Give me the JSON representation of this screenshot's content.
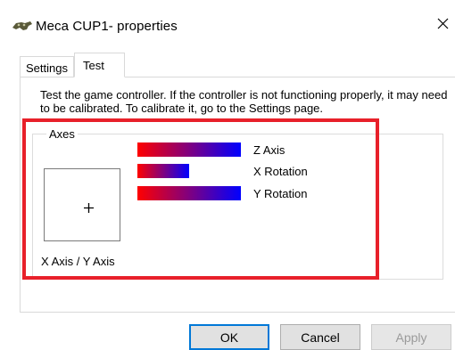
{
  "window": {
    "title": "Meca CUP1- properties",
    "close_label": "✕"
  },
  "tabs": [
    {
      "label": "Settings",
      "active": false
    },
    {
      "label": "Test",
      "active": true
    }
  ],
  "test_panel": {
    "description": "Test the game controller.  If the controller is not functioning properly, it may need to be calibrated.  To calibrate it, go to the Settings page.",
    "axes_group_label": "Axes",
    "xy_label": "X Axis / Y Axis",
    "bars": [
      {
        "label": "Z Axis",
        "level": 1.0
      },
      {
        "label": "X Rotation",
        "level": 0.5
      },
      {
        "label": "Y Rotation",
        "level": 1.0
      }
    ]
  },
  "buttons": {
    "ok": "OK",
    "cancel": "Cancel",
    "apply": "Apply"
  },
  "colors": {
    "highlight": "#e8202a",
    "bar_start": "#ff0000",
    "bar_end": "#0000ff",
    "focus_border": "#0078d7"
  },
  "icons": {
    "title": "game-controller-icon",
    "close": "close-icon"
  }
}
